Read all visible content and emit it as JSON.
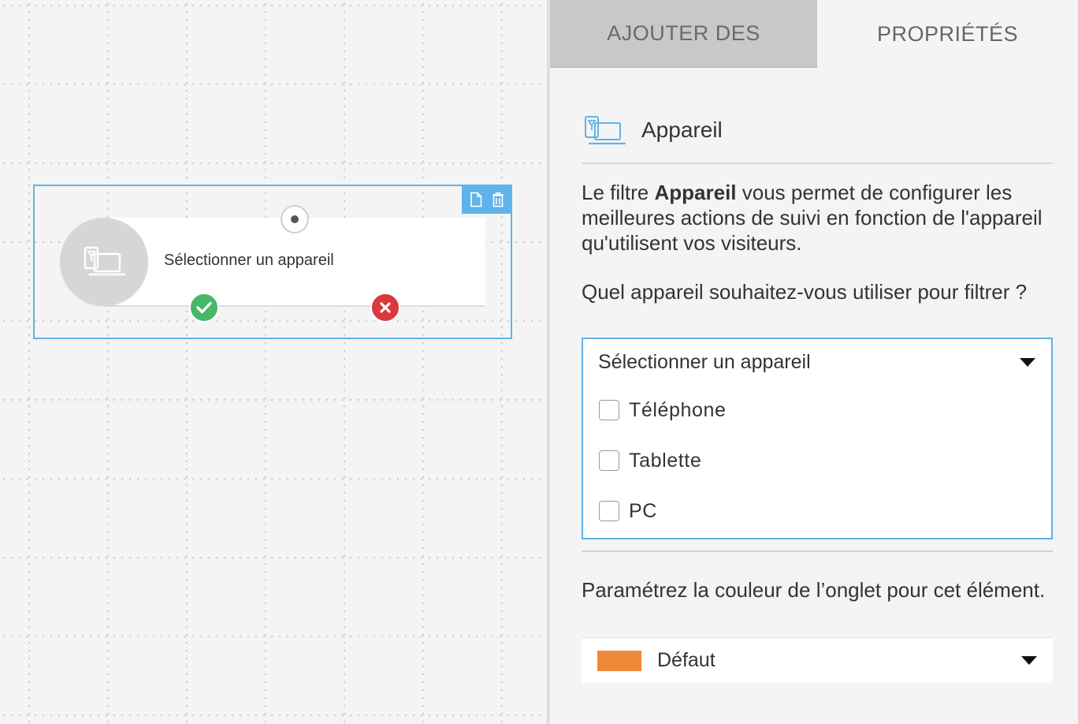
{
  "canvas": {
    "node": {
      "title": "Sélectionner un appareil"
    }
  },
  "tabs": {
    "add_label": "AJOUTER DES",
    "properties_label": "PROPRIÉTÉS"
  },
  "properties": {
    "header_title": "Appareil",
    "description_prefix": "Le filtre ",
    "description_bold": "Appareil",
    "description_suffix": " vous permet de configurer les meilleures actions de suivi en fonction de l'appareil qu'utilisent vos visiteurs.",
    "question": "Quel appareil souhaitez-vous utiliser pour filtrer ?",
    "device_select": {
      "placeholder": "Sélectionner un appareil",
      "options": [
        "Téléphone",
        "Tablette",
        "PC"
      ]
    },
    "color_label": "Paramétrez la couleur de l’onglet pour cet élément.",
    "color_select": {
      "value": "Défaut",
      "swatch_color": "#f0883a"
    }
  },
  "colors": {
    "accent": "#5fb3ea",
    "success": "#45b86a",
    "danger": "#d9383c"
  }
}
